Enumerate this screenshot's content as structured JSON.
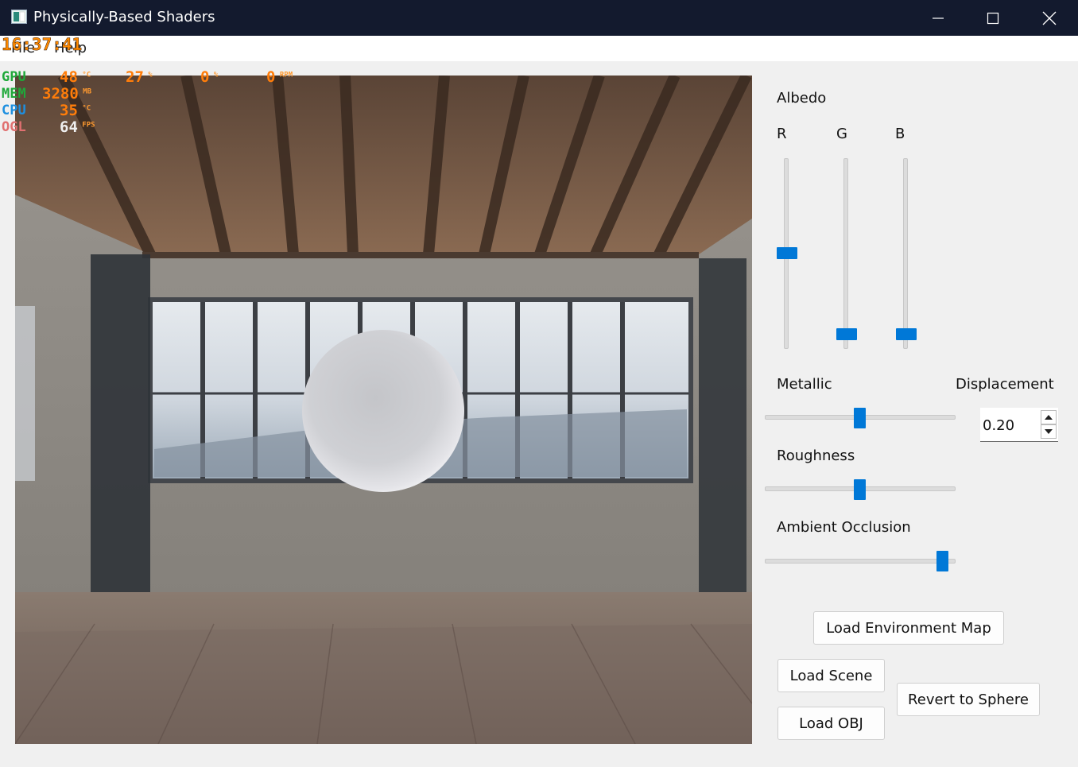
{
  "window": {
    "title": "Physically-Based Shaders",
    "minimize_icon": "minimize-icon",
    "maximize_icon": "maximize-icon",
    "close_icon": "close-icon"
  },
  "menu": {
    "file": "File",
    "help": "Help"
  },
  "overlay": {
    "time": "16:37:41",
    "rows": [
      {
        "label": "GPU",
        "label_color": "#1fa83a",
        "values": [
          {
            "value": "48",
            "unit": "°C"
          },
          {
            "value": "27",
            "unit": "%"
          },
          {
            "value": "0",
            "unit": "%"
          },
          {
            "value": "0",
            "unit": "RPM"
          }
        ]
      },
      {
        "label": "MEM",
        "label_color": "#1fa83a",
        "values": [
          {
            "value": "3280",
            "unit": "MB"
          }
        ]
      },
      {
        "label": "CPU",
        "label_color": "#1d8fe0",
        "values": [
          {
            "value": "35",
            "unit": "°C"
          }
        ]
      },
      {
        "label": "OGL",
        "label_color": "#e07070",
        "values": [
          {
            "value": "64",
            "unit": "FPS"
          }
        ]
      }
    ]
  },
  "controls": {
    "albedo_label": "Albedo",
    "r_label": "R",
    "g_label": "G",
    "b_label": "B",
    "albedo_levels": {
      "r": 0.5,
      "g": 0.04,
      "b": 0.04
    },
    "metallic_label": "Metallic",
    "metallic_level": 0.5,
    "displacement_label": "Displacement",
    "displacement_value": "0.20",
    "roughness_label": "Roughness",
    "roughness_level": 0.5,
    "ao_label": "Ambient Occlusion",
    "ao_level": 0.97
  },
  "buttons": {
    "load_env": "Load Environment Map",
    "load_scene": "Load Scene",
    "load_obj": "Load OBJ",
    "revert_sphere": "Revert to Sphere"
  },
  "colors": {
    "accent": "#0078d7",
    "titlebar": "#131a2e"
  }
}
